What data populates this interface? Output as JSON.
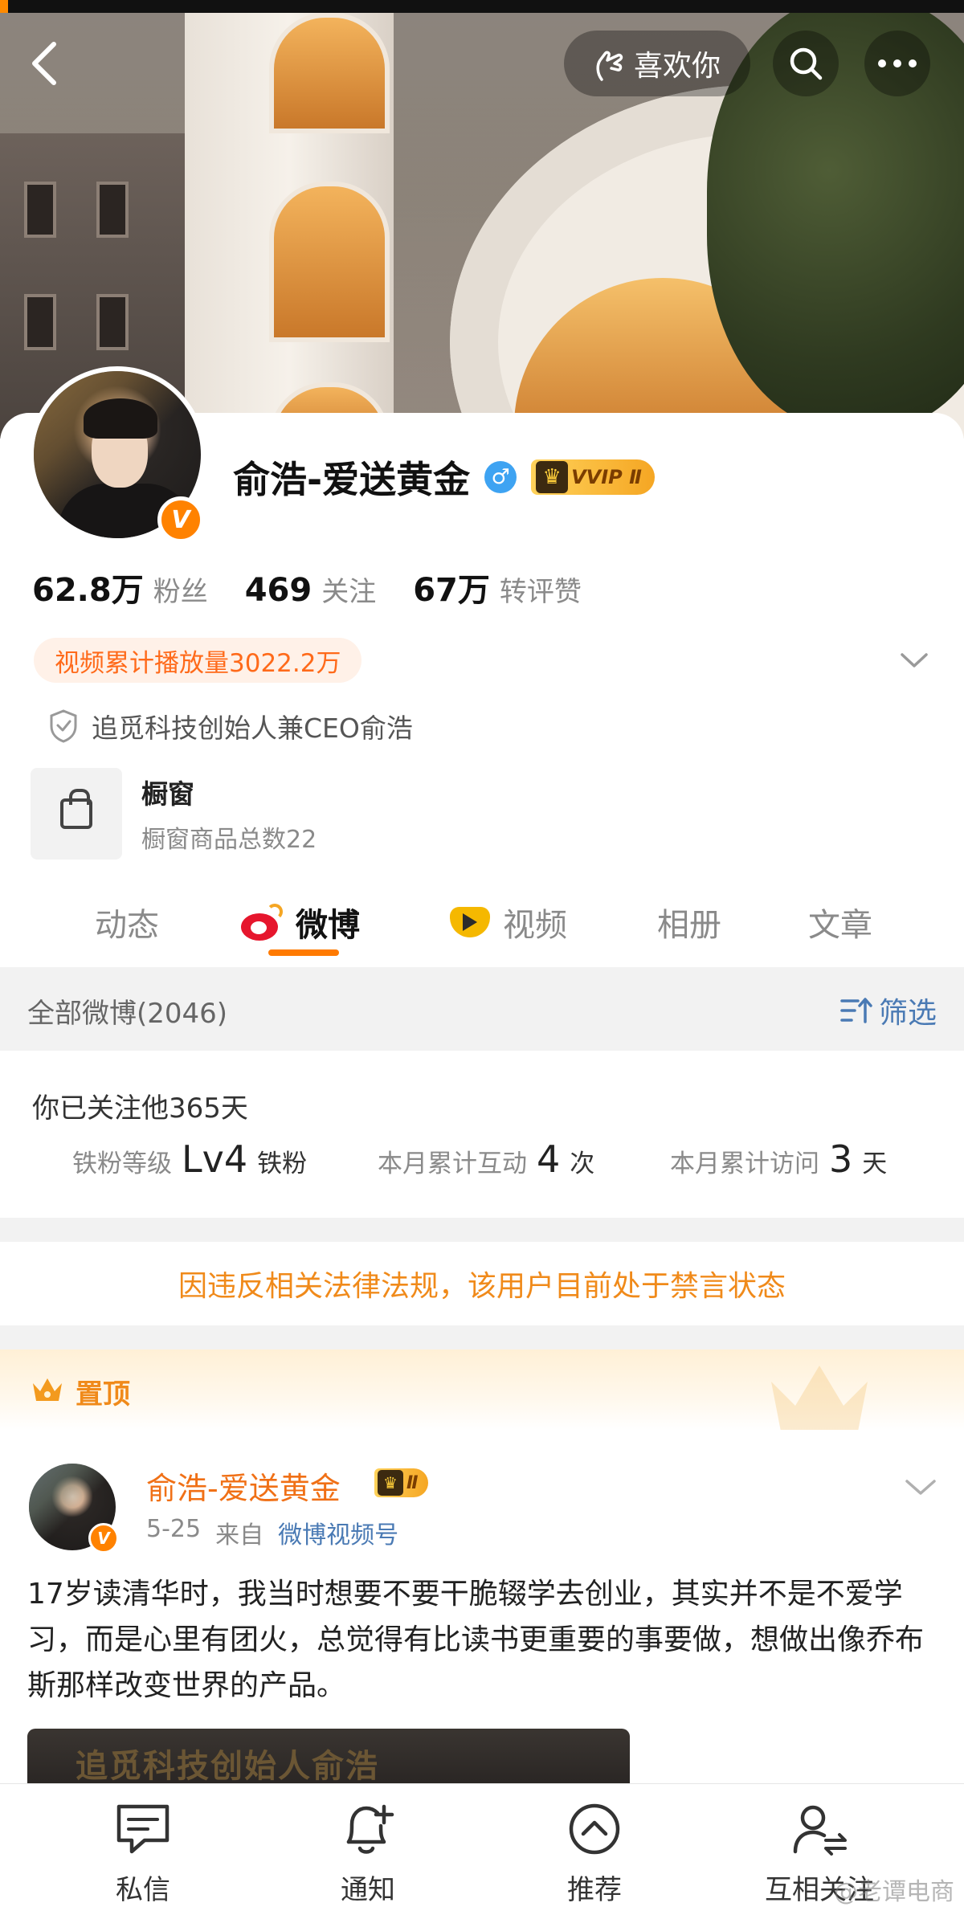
{
  "header": {
    "like_label": "喜欢你"
  },
  "profile": {
    "name": "俞浩-爱送黄金",
    "vip_label": "VVIP Ⅱ",
    "gender_symbol": "♂",
    "verified_mark": "V",
    "stats": [
      {
        "value": "62.8万",
        "label": "粉丝"
      },
      {
        "value": "469",
        "label": "关注"
      },
      {
        "value": "67万",
        "label": "转评赞"
      }
    ],
    "play_count": "视频累计播放量3022.2万",
    "verification": "追觅科技创始人兼CEO俞浩",
    "shop": {
      "title": "橱窗",
      "subtitle": "橱窗商品总数22"
    }
  },
  "tabs": [
    {
      "label": "动态",
      "active": false
    },
    {
      "label": "微博",
      "active": true
    },
    {
      "label": "视频",
      "active": false
    },
    {
      "label": "相册",
      "active": false
    },
    {
      "label": "文章",
      "active": false
    }
  ],
  "feed": {
    "count_label": "全部微博(2046)",
    "filter_label": "筛选",
    "follow": {
      "days_text": "你已关注他365天",
      "fan_level_label": "铁粉等级",
      "fan_level_value": "Lv4",
      "fan_level_unit": "铁粉",
      "interact_label": "本月累计互动",
      "interact_value": "4",
      "interact_unit": "次",
      "visit_label": "本月累计访问",
      "visit_value": "3",
      "visit_unit": "天"
    },
    "banned_notice": "因违反相关法律法规，该用户目前处于禁言状态",
    "pinned_label": "置顶",
    "post": {
      "author": "俞浩-爱送黄金",
      "vip_label": "Ⅱ",
      "date": "5-25",
      "from_label": "来自",
      "source": "微博视频号",
      "text": "17岁读清华时，我当时想要不要干脆辍学去创业，其实并不是不爱学习，而是心里有团火，总觉得有比读书更重要的事要做，想做出像乔布斯那样改变世界的产品。",
      "media_caption": "追觅科技创始人俞浩"
    }
  },
  "bottom_nav": [
    {
      "label": "私信",
      "icon": "message-icon"
    },
    {
      "label": "通知",
      "icon": "bell-add-icon"
    },
    {
      "label": "推荐",
      "icon": "chevron-up-circle-icon"
    },
    {
      "label": "互相关注",
      "icon": "mutual-follow-icon"
    }
  ],
  "watermark": "@老谭电商",
  "colors": {
    "accent": "#ff7a00",
    "link_blue": "#4a7ab4",
    "notice_orange": "#f08a1a",
    "weibo_red": "#e6162d"
  }
}
